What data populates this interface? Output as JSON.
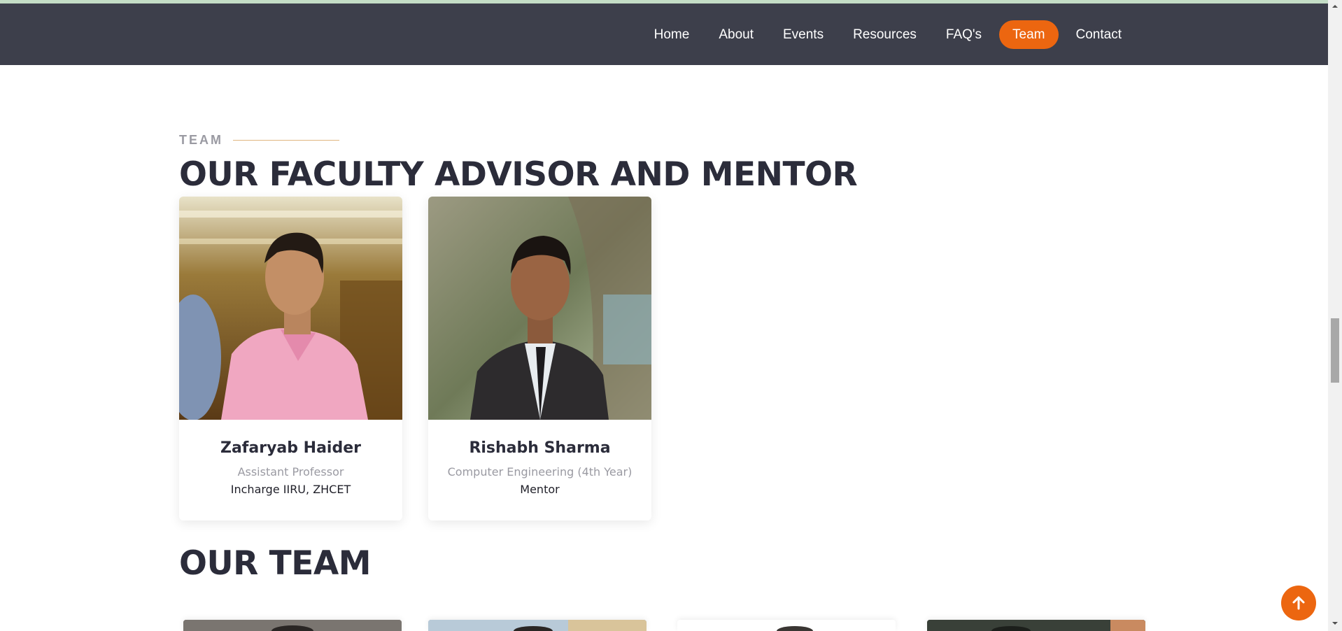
{
  "nav": {
    "items": [
      {
        "label": "Home",
        "active": false
      },
      {
        "label": "About",
        "active": false
      },
      {
        "label": "Events",
        "active": false
      },
      {
        "label": "Resources",
        "active": false
      },
      {
        "label": "FAQ's",
        "active": false
      },
      {
        "label": "Team",
        "active": true
      },
      {
        "label": "Contact",
        "active": false
      }
    ]
  },
  "section": {
    "tag": "TEAM",
    "faculty_heading": "OUR FACULTY ADVISOR AND MENTOR",
    "team_heading": "OUR TEAM"
  },
  "advisors": [
    {
      "name": "Zafaryab Haider",
      "role": "Assistant Professor",
      "sub": "Incharge IIRU, ZHCET"
    },
    {
      "name": "Rishabh Sharma",
      "role": "Computer Engineering (4th Year)",
      "sub": "Mentor"
    }
  ],
  "icons": {
    "scroll_top": "arrow-up-icon"
  },
  "colors": {
    "accent": "#ec6610",
    "navbar": "#3d3f4b",
    "heading": "#2b2c3a"
  }
}
